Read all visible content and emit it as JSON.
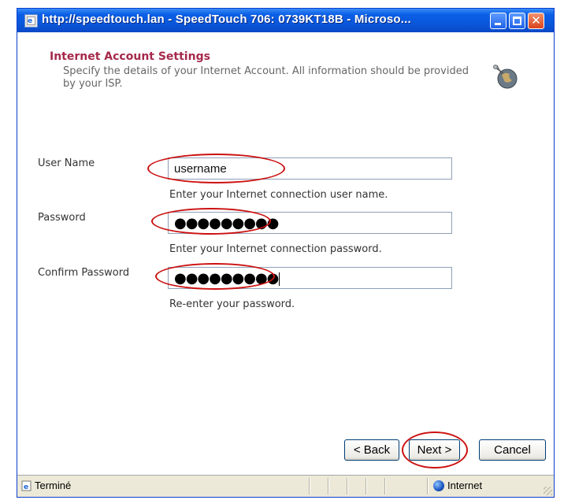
{
  "window": {
    "title": "http://speedtouch.lan - SpeedTouch 706:  0739KT18B - Microso...",
    "title_icon": "ie-page-icon"
  },
  "form": {
    "heading": "Internet Account Settings",
    "description": "Specify the details of your Internet Account. All information should be provided by your ISP.",
    "header_icon": "globe-network-icon",
    "fields": [
      {
        "label": "User Name",
        "value": "username",
        "hint": "Enter your Internet connection user name."
      },
      {
        "label": "Password",
        "value": "●●●●●●●●●",
        "hint": "Enter your Internet connection password."
      },
      {
        "label": "Confirm Password",
        "value": "●●●●●●●●●",
        "hint": "Re-enter your password."
      }
    ]
  },
  "buttons": {
    "back": "< Back",
    "next": "Next >",
    "cancel": "Cancel"
  },
  "statusbar": {
    "status": "Terminé",
    "zone": "Internet"
  },
  "colors": {
    "heading": "#a5294a",
    "highlight": "#cc1111",
    "titlebar": "#0a55d8"
  }
}
